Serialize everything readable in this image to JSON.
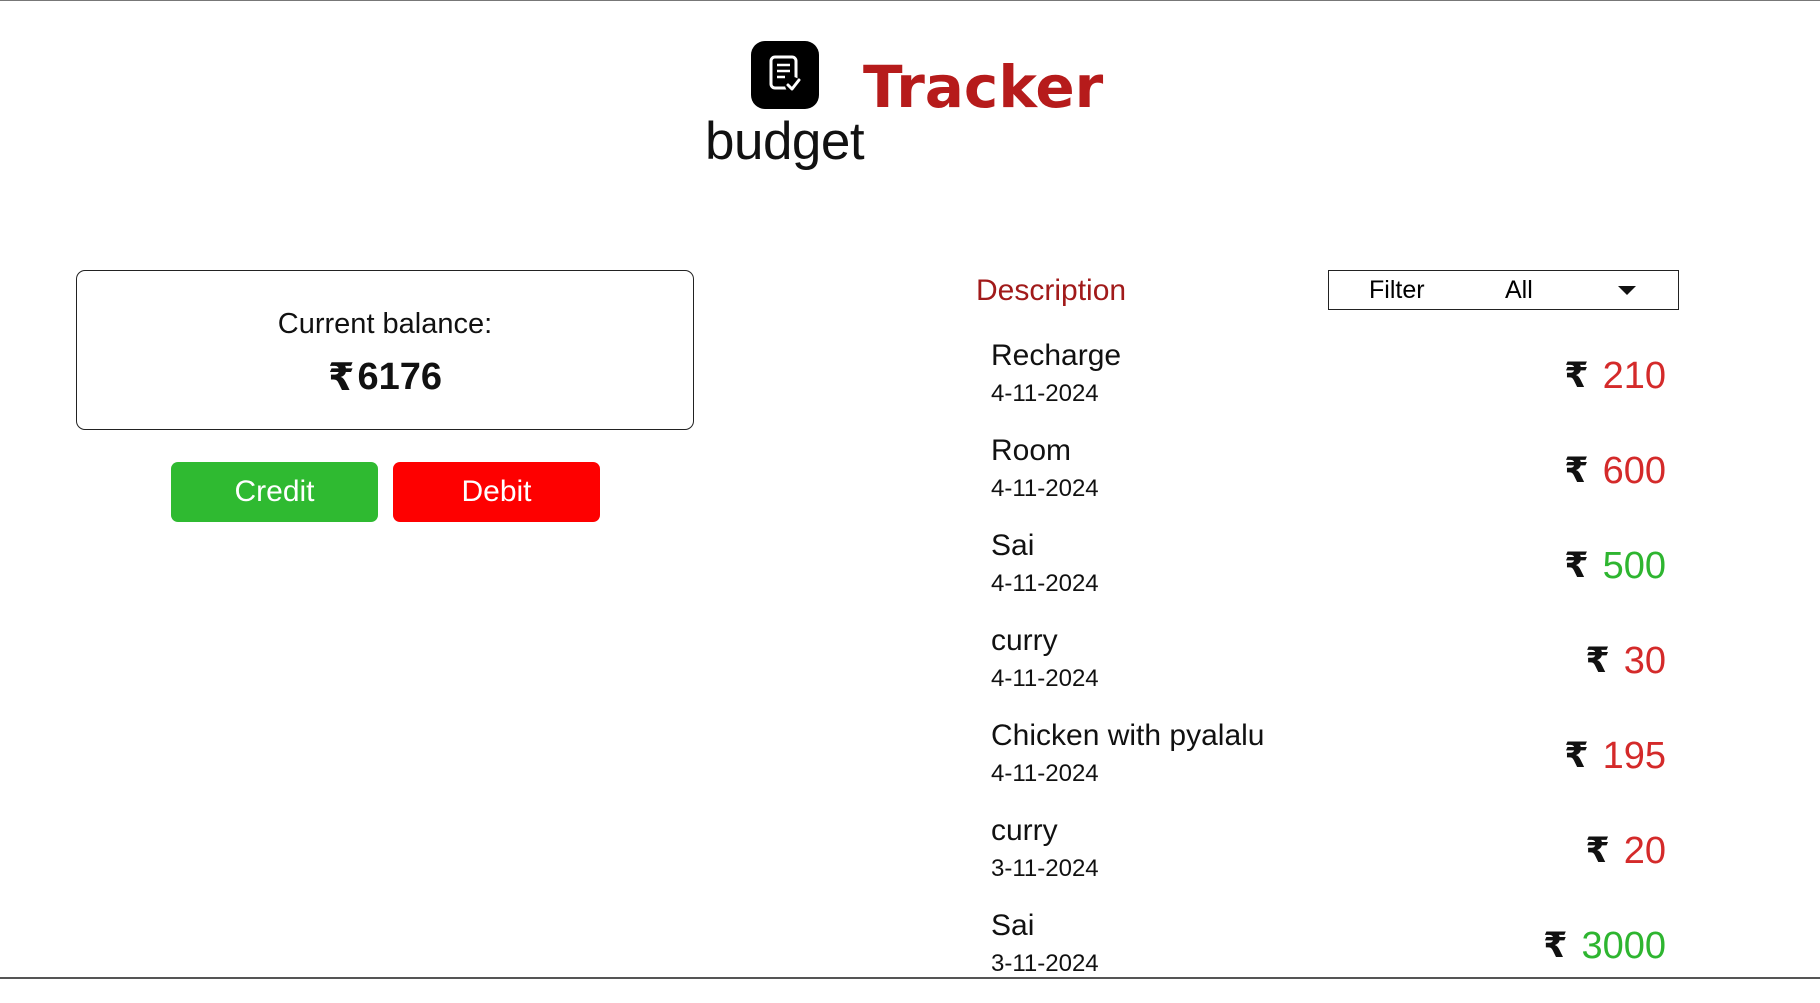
{
  "header": {
    "logo_icon": "receipt-check-icon",
    "brand_word_1": "budget",
    "brand_word_2": "Tracker"
  },
  "balance": {
    "label": "Current balance:",
    "currency_symbol": "₹",
    "amount": "6176"
  },
  "actions": {
    "credit_label": "Credit",
    "debit_label": "Debit"
  },
  "transactions": {
    "header": "Description",
    "filter": {
      "label": "Filter",
      "selected": "All"
    },
    "currency_symbol": "₹",
    "items": [
      {
        "title": "Recharge",
        "date": "4-11-2024",
        "amount": "210",
        "type": "debit"
      },
      {
        "title": "Room",
        "date": "4-11-2024",
        "amount": "600",
        "type": "debit"
      },
      {
        "title": "Sai",
        "date": "4-11-2024",
        "amount": "500",
        "type": "credit"
      },
      {
        "title": "curry",
        "date": "4-11-2024",
        "amount": "30",
        "type": "debit"
      },
      {
        "title": "Chicken with pyalalu",
        "date": "4-11-2024",
        "amount": "195",
        "type": "debit"
      },
      {
        "title": "curry",
        "date": "3-11-2024",
        "amount": "20",
        "type": "debit"
      },
      {
        "title": "Sai",
        "date": "3-11-2024",
        "amount": "3000",
        "type": "credit"
      }
    ]
  },
  "colors": {
    "brand_red": "#b61b1b",
    "credit_green": "#2fba31",
    "debit_red": "#fe0000",
    "amount_debit": "#d42a2a",
    "amount_credit": "#2eb530"
  }
}
